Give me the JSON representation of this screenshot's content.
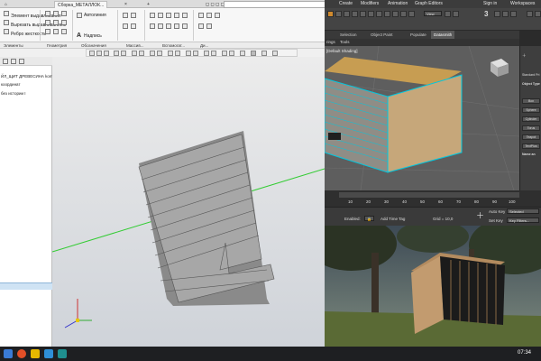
{
  "cad": {
    "doc_tab": "Сборка_МЕТАЛЛОК...",
    "ribbon": {
      "select_items": [
        "Элемент выдавливания",
        "Вырезать выдавливанием",
        "Ребро жесткости"
      ],
      "autoline_label": "Автолиния",
      "text_label": "Надпись"
    },
    "groups": [
      "Элементы",
      "Геометрия",
      "Обозначения",
      "Массив...",
      "Вспомогат...",
      "Ди..."
    ],
    "tree": {
      "title_line": "ЙЛ_ЩИТ ДРЕВЕСИНА kompas",
      "line2": "координат",
      "line3": "без истории I"
    }
  },
  "max": {
    "menus": [
      "Create",
      "Modifiers",
      "Animation",
      "Graph Editors",
      "Sign in",
      "Workspaces"
    ],
    "subtabs": [
      "Selection",
      "Object Paint",
      "Populate",
      "Datasmith"
    ],
    "active_subtab": "Datasmith",
    "scene_explorer_items": [
      "rings",
      "Tools"
    ],
    "viewport_label": "Default Shading",
    "cmd_panel": {
      "title": "Object Type",
      "standard_label": "Standard Pri",
      "buttons": [
        "Box",
        "Sphere",
        "Cylinder",
        "Torus",
        "Teapot",
        "TextPlus"
      ],
      "name_label": "Name an"
    },
    "timeline": {
      "ticks": [
        "10",
        "20",
        "30",
        "40",
        "50",
        "60",
        "70",
        "80",
        "90",
        "100"
      ]
    },
    "status": {
      "enabled_label": "Enabled:",
      "add_time_tag": "Add Time Tag",
      "grid": "Grid = 10,0",
      "auto_key": "Auto Key",
      "selected": "Selected",
      "set_key": "Set Key",
      "key_filters": "Key Filters..."
    },
    "toolbar_view": "View",
    "counter": "3"
  },
  "taskbar": {
    "time": "07:34"
  },
  "colors": {
    "cad_selected_outline": "#00c8e0",
    "axis_line": "#33cc33",
    "max_bg": "#444444"
  }
}
